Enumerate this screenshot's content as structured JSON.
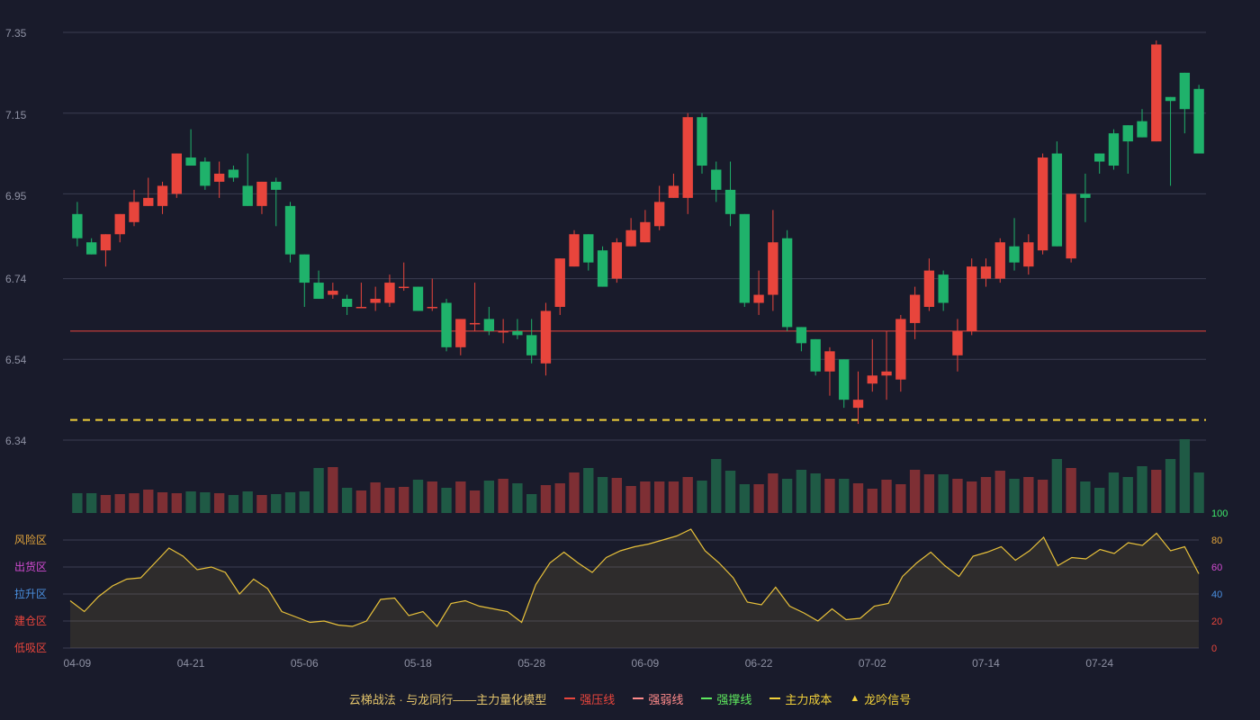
{
  "colors": {
    "up": "#e8453c",
    "down": "#1fb26b",
    "grid": "#3a3d52",
    "resistance": "#e8453c",
    "cost": "#f1d03a",
    "osc_line": "#e8c13a"
  },
  "price_axis": {
    "ticks": [
      "7.35",
      "7.15",
      "6.95",
      "6.74",
      "6.54",
      "6.34"
    ],
    "min": 6.34,
    "max": 7.35
  },
  "oscillator_axis": {
    "ticks": [
      "100",
      "80",
      "60",
      "40",
      "20",
      "0"
    ]
  },
  "zones": [
    {
      "label": "风险区",
      "color": "#e2a43b"
    },
    {
      "label": "出货区",
      "color": "#d14bd1"
    },
    {
      "label": "拉升区",
      "color": "#4a8fe0"
    },
    {
      "label": "建仓区",
      "color": "#e8453c"
    },
    {
      "label": "低吸区",
      "color": "#e8453c"
    }
  ],
  "legend": {
    "title": "云梯战法 · 与龙同行——主力量化模型",
    "items": [
      {
        "label": "强压线",
        "color": "#e8453c",
        "style": "solid",
        "icon": "line-icon"
      },
      {
        "label": "强弱线",
        "color": "#ff8a8a",
        "style": "dashed",
        "icon": "dashed-line-icon"
      },
      {
        "label": "强撑线",
        "color": "#5ee85e",
        "style": "solid",
        "icon": "line-icon"
      },
      {
        "label": "主力成本",
        "color": "#f1d03a",
        "style": "dashed",
        "icon": "dashed-line-icon"
      },
      {
        "label": "龙吟信号",
        "color": "#f1d03a",
        "style": "triangle",
        "icon": "triangle-icon"
      }
    ]
  },
  "chart_data": {
    "type": "candlestick",
    "x_tick_labels": [
      {
        "index": 0,
        "label": "04-09"
      },
      {
        "index": 8,
        "label": "04-21"
      },
      {
        "index": 16,
        "label": "05-06"
      },
      {
        "index": 24,
        "label": "05-18"
      },
      {
        "index": 32,
        "label": "05-28"
      },
      {
        "index": 40,
        "label": "06-09"
      },
      {
        "index": 48,
        "label": "06-22"
      },
      {
        "index": 56,
        "label": "07-02"
      },
      {
        "index": 64,
        "label": "07-14"
      },
      {
        "index": 72,
        "label": "07-24"
      }
    ],
    "reference_lines": {
      "resistance": 6.61,
      "main_cost": 6.39
    },
    "candles": [
      [
        6.9,
        6.84,
        6.93,
        6.82
      ],
      [
        6.83,
        6.8,
        6.84,
        6.8
      ],
      [
        6.81,
        6.85,
        6.85,
        6.77
      ],
      [
        6.85,
        6.9,
        6.9,
        6.83
      ],
      [
        6.88,
        6.93,
        6.96,
        6.87
      ],
      [
        6.92,
        6.94,
        6.99,
        6.92
      ],
      [
        6.92,
        6.97,
        6.98,
        6.9
      ],
      [
        6.95,
        7.05,
        7.05,
        6.94
      ],
      [
        7.04,
        7.02,
        7.11,
        7.02
      ],
      [
        7.03,
        6.97,
        7.04,
        6.96
      ],
      [
        6.98,
        7.0,
        7.03,
        6.94
      ],
      [
        7.01,
        6.99,
        7.02,
        6.98
      ],
      [
        6.97,
        6.92,
        7.05,
        6.92
      ],
      [
        6.92,
        6.98,
        6.98,
        6.9
      ],
      [
        6.98,
        6.96,
        6.99,
        6.87
      ],
      [
        6.92,
        6.8,
        6.93,
        6.78
      ],
      [
        6.8,
        6.73,
        6.8,
        6.67
      ],
      [
        6.73,
        6.69,
        6.76,
        6.69
      ],
      [
        6.7,
        6.71,
        6.73,
        6.69
      ],
      [
        6.69,
        6.67,
        6.7,
        6.65
      ],
      [
        6.67,
        6.67,
        6.73,
        6.67
      ],
      [
        6.68,
        6.69,
        6.72,
        6.66
      ],
      [
        6.68,
        6.73,
        6.75,
        6.67
      ],
      [
        6.72,
        6.72,
        6.78,
        6.71
      ],
      [
        6.72,
        6.66,
        6.72,
        6.66
      ],
      [
        6.67,
        6.67,
        6.74,
        6.66
      ],
      [
        6.68,
        6.57,
        6.69,
        6.56
      ],
      [
        6.57,
        6.64,
        6.64,
        6.55
      ],
      [
        6.63,
        6.63,
        6.73,
        6.61
      ],
      [
        6.64,
        6.61,
        6.67,
        6.6
      ],
      [
        6.61,
        6.61,
        6.64,
        6.58
      ],
      [
        6.61,
        6.6,
        6.64,
        6.59
      ],
      [
        6.6,
        6.55,
        6.64,
        6.53
      ],
      [
        6.53,
        6.66,
        6.68,
        6.5
      ],
      [
        6.67,
        6.79,
        6.79,
        6.65
      ],
      [
        6.77,
        6.85,
        6.86,
        6.77
      ],
      [
        6.85,
        6.78,
        6.85,
        6.76
      ],
      [
        6.81,
        6.72,
        6.82,
        6.72
      ],
      [
        6.74,
        6.83,
        6.84,
        6.73
      ],
      [
        6.82,
        6.86,
        6.89,
        6.82
      ],
      [
        6.83,
        6.88,
        6.91,
        6.83
      ],
      [
        6.87,
        6.93,
        6.97,
        6.86
      ],
      [
        6.94,
        6.97,
        7.0,
        6.94
      ],
      [
        6.94,
        7.14,
        7.15,
        6.9
      ],
      [
        7.14,
        7.02,
        7.15,
        7.0
      ],
      [
        7.01,
        6.96,
        7.03,
        6.93
      ],
      [
        6.96,
        6.9,
        7.03,
        6.87
      ],
      [
        6.9,
        6.68,
        6.9,
        6.67
      ],
      [
        6.68,
        6.7,
        6.76,
        6.65
      ],
      [
        6.7,
        6.83,
        6.91,
        6.66
      ],
      [
        6.84,
        6.62,
        6.86,
        6.61
      ],
      [
        6.62,
        6.58,
        6.62,
        6.56
      ],
      [
        6.59,
        6.51,
        6.59,
        6.5
      ],
      [
        6.51,
        6.56,
        6.57,
        6.45
      ],
      [
        6.54,
        6.44,
        6.54,
        6.42
      ],
      [
        6.42,
        6.44,
        6.51,
        6.38
      ],
      [
        6.48,
        6.5,
        6.59,
        6.46
      ],
      [
        6.5,
        6.51,
        6.61,
        6.44
      ],
      [
        6.49,
        6.64,
        6.65,
        6.46
      ],
      [
        6.63,
        6.7,
        6.72,
        6.59
      ],
      [
        6.67,
        6.76,
        6.79,
        6.66
      ],
      [
        6.75,
        6.68,
        6.76,
        6.66
      ],
      [
        6.55,
        6.61,
        6.64,
        6.51
      ],
      [
        6.61,
        6.77,
        6.79,
        6.6
      ],
      [
        6.74,
        6.77,
        6.79,
        6.72
      ],
      [
        6.74,
        6.83,
        6.84,
        6.73
      ],
      [
        6.82,
        6.78,
        6.89,
        6.76
      ],
      [
        6.77,
        6.83,
        6.85,
        6.75
      ],
      [
        6.81,
        7.04,
        7.05,
        6.8
      ],
      [
        7.05,
        6.82,
        7.08,
        6.82
      ],
      [
        6.79,
        6.95,
        6.95,
        6.78
      ],
      [
        6.95,
        6.94,
        7.0,
        6.88
      ],
      [
        7.05,
        7.03,
        7.05,
        7.0
      ],
      [
        7.1,
        7.02,
        7.11,
        7.01
      ],
      [
        7.12,
        7.08,
        7.12,
        7.0
      ],
      [
        7.13,
        7.09,
        7.16,
        7.09
      ],
      [
        7.08,
        7.32,
        7.33,
        7.08
      ],
      [
        7.19,
        7.18,
        7.19,
        6.97
      ],
      [
        7.25,
        7.16,
        7.25,
        7.1
      ],
      [
        7.21,
        7.05,
        7.22,
        7.05
      ]
    ],
    "volume": [
      22,
      22,
      20,
      21,
      22,
      26,
      23,
      22,
      24,
      23,
      22,
      20,
      24,
      20,
      21,
      23,
      24,
      50,
      51,
      28,
      25,
      34,
      28,
      29,
      37,
      35,
      28,
      35,
      25,
      36,
      38,
      33,
      21,
      31,
      33,
      45,
      50,
      40,
      39,
      30,
      35,
      35,
      35,
      40,
      36,
      60,
      47,
      32,
      32,
      44,
      38,
      48,
      44,
      38,
      38,
      33,
      27,
      37,
      32,
      48,
      43,
      43,
      38,
      35,
      40,
      47,
      38,
      40,
      37,
      60,
      50,
      35,
      28,
      45,
      40,
      52,
      48,
      60,
      82,
      45
    ],
    "volume_max": 82,
    "oscillator": [
      35,
      27,
      38,
      46,
      51,
      52,
      63,
      74,
      68,
      58,
      60,
      56,
      40,
      51,
      44,
      27,
      23,
      19,
      20,
      17,
      16,
      20,
      36,
      37,
      24,
      27,
      16,
      33,
      35,
      31,
      29,
      27,
      19,
      47,
      63,
      71,
      63,
      56,
      67,
      72,
      75,
      77,
      80,
      83,
      88,
      72,
      63,
      52,
      34,
      32,
      45,
      31,
      26,
      20,
      29,
      21,
      22,
      31,
      33,
      53,
      63,
      71,
      61,
      53,
      68,
      71,
      75,
      65,
      72,
      82,
      61,
      67,
      66,
      73,
      70,
      78,
      76,
      85,
      72,
      75,
      55
    ],
    "oscillator_range": [
      0,
      100
    ]
  }
}
